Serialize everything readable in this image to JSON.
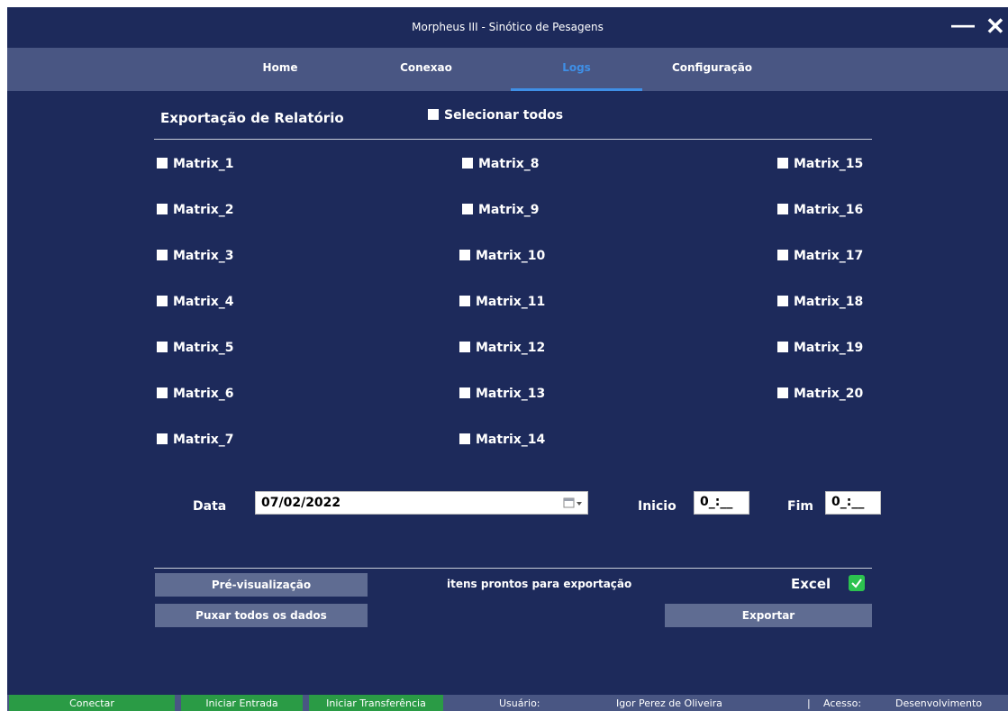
{
  "window": {
    "title": "Morpheus III - Sinótico de Pesagens",
    "minimize": "—",
    "close": "✕"
  },
  "nav": {
    "tabs": [
      {
        "label": "Home"
      },
      {
        "label": "Conexao"
      },
      {
        "label": "Logs",
        "active": true
      },
      {
        "label": "Configuração"
      }
    ]
  },
  "export": {
    "title": "Exportação de Relatório",
    "select_all": "Selecionar todos",
    "matrices": [
      "Matrix_1",
      "Matrix_2",
      "Matrix_3",
      "Matrix_4",
      "Matrix_5",
      "Matrix_6",
      "Matrix_7",
      "Matrix_8",
      "Matrix_9",
      "Matrix_10",
      "Matrix_11",
      "Matrix_12",
      "Matrix_13",
      "Matrix_14",
      "Matrix_15",
      "Matrix_16",
      "Matrix_17",
      "Matrix_18",
      "Matrix_19",
      "Matrix_20"
    ]
  },
  "filters": {
    "date_label": "Data",
    "date_value": "07/02/2022",
    "start_label": "Inicio",
    "start_value": "0_:__",
    "end_label": "Fim",
    "end_value": "0_:__"
  },
  "actions": {
    "preview": "Pré-visualização",
    "pull_all": "Puxar todos os dados",
    "status": "itens prontos para exportação",
    "excel_label": "Excel",
    "excel_checked": true,
    "export": "Exportar"
  },
  "statusbar": {
    "connect": "Conectar",
    "start_entry": "Iniciar Entrada",
    "start_transfer": "Iniciar Transferência",
    "user_label": "Usuário:",
    "user_value": "Igor Perez de Oliveira",
    "separator": "|",
    "access_label": "Acesso:",
    "access_value": "Desenvolvimento"
  },
  "colors": {
    "background": "#1d2a5b",
    "nav": "#495683",
    "accent": "#3f8fe6",
    "button": "#5f6c92",
    "green": "#2a9b45"
  }
}
